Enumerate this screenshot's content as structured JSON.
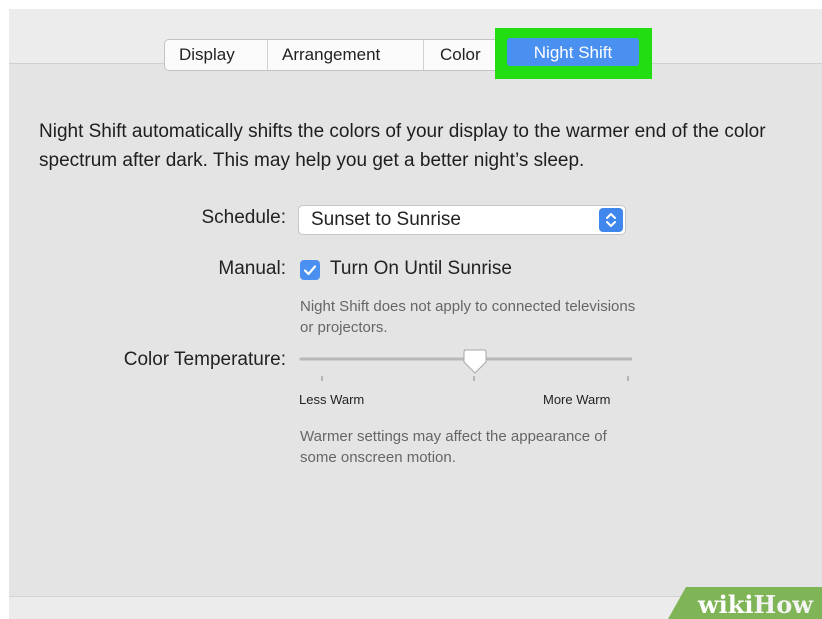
{
  "tabs": [
    {
      "label": "Display",
      "selected": false
    },
    {
      "label": "Arrangement",
      "selected": false
    },
    {
      "label": "Color",
      "selected": false
    },
    {
      "label": "Night Shift",
      "selected": true
    }
  ],
  "description": "Night Shift automatically shifts the colors of your display to the warmer end of the color spectrum after dark. This may help you get a better night’s sleep.",
  "schedule": {
    "label": "Schedule:",
    "value": "Sunset to Sunrise"
  },
  "manual": {
    "label": "Manual:",
    "checkbox_label": "Turn On Until Sunrise",
    "checked": true,
    "note": "Night Shift does not apply to connected televisions or projectors."
  },
  "color_temperature": {
    "label": "Color Temperature:",
    "min_label": "Less Warm",
    "max_label": "More Warm",
    "level": 0.5,
    "note": "Warmer settings may affect the appearance of some onscreen motion."
  },
  "colors": {
    "accent": "#4a90f0",
    "highlight": "#22dd11",
    "panel_bg": "#e4e4e4"
  },
  "watermark": "wikiHow"
}
